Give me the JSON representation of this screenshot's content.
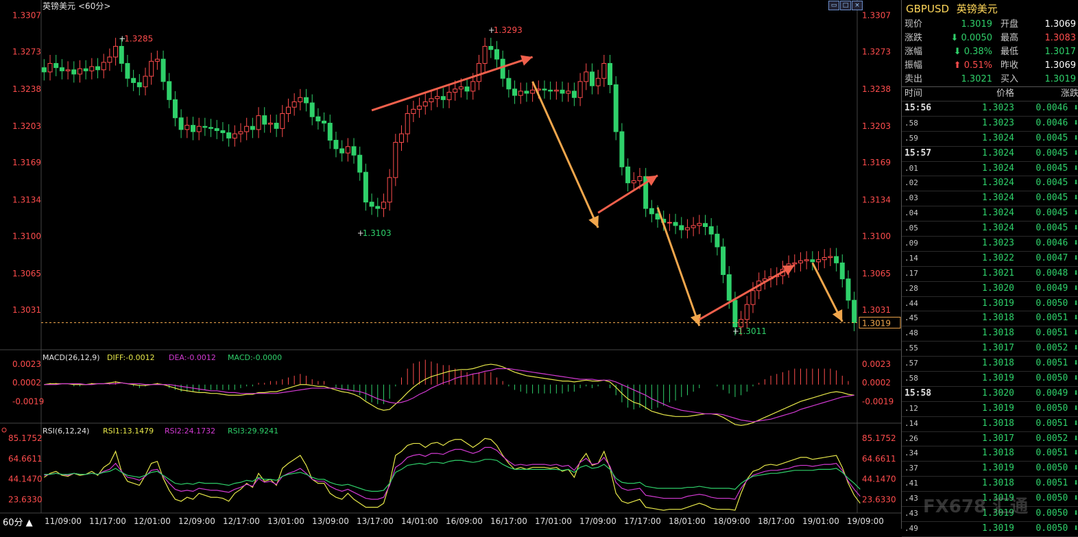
{
  "chart_title": "英镑美元",
  "chart_period_tag": "<60分>",
  "period_button": "60分 ▲",
  "window_icons": [
    "restore-icon",
    "maximize-icon",
    "close-icon"
  ],
  "watermark": "FX678 汇通",
  "colors": {
    "up": "#ff4d4d",
    "down": "#2fd06a",
    "bg": "#000000",
    "axis_price": "#ff4d4d",
    "arrow_red": "#f0604c",
    "arrow_orange": "#f0a64c",
    "macd_dif": "#e8e84a",
    "macd_dea": "#d23ad2",
    "rsi1": "#e8e84a",
    "rsi2": "#d23ad2",
    "rsi3": "#2fd06a"
  },
  "quote": {
    "code": "GBPUSD",
    "name": "英镑美元",
    "rows": [
      {
        "l1": "现价",
        "v1": "1.3019",
        "c1": "down",
        "l2": "开盘",
        "v2": "1.3069",
        "c2": "white"
      },
      {
        "l1": "涨跌",
        "v1": "0.0050",
        "c1": "down",
        "a1": "down",
        "l2": "最高",
        "v2": "1.3083",
        "c2": "up"
      },
      {
        "l1": "涨幅",
        "v1": "0.38%",
        "c1": "down",
        "a1": "down",
        "l2": "最低",
        "v2": "1.3017",
        "c2": "down"
      },
      {
        "l1": "振幅",
        "v1": "0.51%",
        "c1": "up",
        "a1": "up",
        "l2": "昨收",
        "v2": "1.3069",
        "c2": "white"
      },
      {
        "l1": "卖出",
        "v1": "1.3021",
        "c1": "down",
        "l2": "买入",
        "v2": "1.3019",
        "c2": "down"
      }
    ]
  },
  "ticks": {
    "headers": [
      "时间",
      "价格",
      "涨跌"
    ],
    "rows": [
      {
        "t": "15:56",
        "major": true,
        "p": "1.3023",
        "c": "0.0046"
      },
      {
        "t": ".58",
        "p": "1.3023",
        "c": "0.0046"
      },
      {
        "t": ".59",
        "p": "1.3024",
        "c": "0.0045"
      },
      {
        "t": "15:57",
        "major": true,
        "p": "1.3024",
        "c": "0.0045"
      },
      {
        "t": ".01",
        "p": "1.3024",
        "c": "0.0045"
      },
      {
        "t": ".02",
        "p": "1.3024",
        "c": "0.0045"
      },
      {
        "t": ".03",
        "p": "1.3024",
        "c": "0.0045"
      },
      {
        "t": ".04",
        "p": "1.3024",
        "c": "0.0045"
      },
      {
        "t": ".05",
        "p": "1.3024",
        "c": "0.0045"
      },
      {
        "t": ".09",
        "p": "1.3023",
        "c": "0.0046"
      },
      {
        "t": ".14",
        "p": "1.3022",
        "c": "0.0047"
      },
      {
        "t": ".17",
        "p": "1.3021",
        "c": "0.0048"
      },
      {
        "t": ".28",
        "p": "1.3020",
        "c": "0.0049"
      },
      {
        "t": ".44",
        "p": "1.3019",
        "c": "0.0050"
      },
      {
        "t": ".45",
        "p": "1.3018",
        "c": "0.0051"
      },
      {
        "t": ".48",
        "p": "1.3018",
        "c": "0.0051"
      },
      {
        "t": ".55",
        "p": "1.3017",
        "c": "0.0052"
      },
      {
        "t": ".57",
        "p": "1.3018",
        "c": "0.0051"
      },
      {
        "t": ".58",
        "p": "1.3019",
        "c": "0.0050"
      },
      {
        "t": "15:58",
        "major": true,
        "p": "1.3020",
        "c": "0.0049"
      },
      {
        "t": ".12",
        "p": "1.3019",
        "c": "0.0050"
      },
      {
        "t": ".14",
        "p": "1.3018",
        "c": "0.0051"
      },
      {
        "t": ".26",
        "p": "1.3017",
        "c": "0.0052"
      },
      {
        "t": ".34",
        "p": "1.3018",
        "c": "0.0051"
      },
      {
        "t": ".37",
        "p": "1.3019",
        "c": "0.0050"
      },
      {
        "t": ".41",
        "p": "1.3018",
        "c": "0.0051"
      },
      {
        "t": ".43",
        "p": "1.3019",
        "c": "0.0050"
      },
      {
        "t": ".43",
        "p": "1.3019",
        "c": "0.0050"
      },
      {
        "t": ".49",
        "p": "1.3019",
        "c": "0.0050"
      }
    ]
  },
  "chart_data": {
    "type": "candlestick",
    "price_ticks": [
      "1.3307",
      "1.3273",
      "1.3238",
      "1.3203",
      "1.3169",
      "1.3134",
      "1.3100",
      "1.3065",
      "1.3031"
    ],
    "price_range": [
      1.3,
      1.3315
    ],
    "current_price": "1.3019",
    "x_labels": [
      "11/09:00",
      "11/17:00",
      "12/01:00",
      "12/09:00",
      "12/17:00",
      "13/01:00",
      "13/09:00",
      "13/17:00",
      "14/01:00",
      "16/09:00",
      "16/17:00",
      "17/01:00",
      "17/09:00",
      "17/17:00",
      "18/01:00",
      "18/09:00",
      "18/17:00",
      "19/01:00",
      "19/09:00"
    ],
    "annotations": [
      {
        "label": "1.3285",
        "index": 13,
        "price": 1.3285
      },
      {
        "label": "1.3293",
        "index": 75,
        "price": 1.3293
      },
      {
        "label": "1.3103",
        "index": 53,
        "price": 1.3103
      },
      {
        "label": "1.3011",
        "index": 116,
        "price": 1.3011
      }
    ],
    "closes": [
      1.3254,
      1.3262,
      1.3258,
      1.3255,
      1.3256,
      1.3252,
      1.3257,
      1.3255,
      1.3259,
      1.3256,
      1.3263,
      1.3268,
      1.3278,
      1.3262,
      1.3248,
      1.3244,
      1.324,
      1.325,
      1.3264,
      1.3266,
      1.3245,
      1.3228,
      1.3211,
      1.32,
      1.3204,
      1.3198,
      1.3203,
      1.3202,
      1.3201,
      1.3199,
      1.3197,
      1.3192,
      1.3196,
      1.3198,
      1.3203,
      1.32,
      1.3213,
      1.3205,
      1.3206,
      1.3201,
      1.3215,
      1.3221,
      1.3226,
      1.323,
      1.3225,
      1.3212,
      1.3208,
      1.3206,
      1.319,
      1.3182,
      1.3178,
      1.3184,
      1.3176,
      1.316,
      1.3132,
      1.3128,
      1.3126,
      1.3132,
      1.3155,
      1.3188,
      1.3196,
      1.3215,
      1.3219,
      1.3222,
      1.3226,
      1.3229,
      1.3231,
      1.3228,
      1.3235,
      1.3238,
      1.324,
      1.3236,
      1.3245,
      1.3262,
      1.3278,
      1.3275,
      1.3266,
      1.3248,
      1.3238,
      1.3232,
      1.3236,
      1.3234,
      1.3237,
      1.3238,
      1.3237,
      1.3236,
      1.3237,
      1.3234,
      1.3236,
      1.323,
      1.3245,
      1.3254,
      1.3241,
      1.3248,
      1.3262,
      1.3242,
      1.3198,
      1.3165,
      1.315,
      1.3152,
      1.3156,
      1.3126,
      1.3121,
      1.3116,
      1.3113,
      1.3113,
      1.311,
      1.3106,
      1.3108,
      1.311,
      1.3112,
      1.3109,
      1.3102,
      1.309,
      1.3064,
      1.304,
      1.3015,
      1.3022,
      1.3036,
      1.3049,
      1.3058,
      1.306,
      1.3062,
      1.3063,
      1.3069,
      1.3074,
      1.3075,
      1.3077,
      1.3078,
      1.3076,
      1.3078,
      1.308,
      1.3081,
      1.3075,
      1.306,
      1.304,
      1.3019
    ],
    "opens": [
      1.3258,
      1.3254,
      1.3262,
      1.3258,
      1.3255,
      1.3256,
      1.3252,
      1.3257,
      1.3255,
      1.3259,
      1.3256,
      1.3263,
      1.3268,
      1.3278,
      1.3262,
      1.3248,
      1.3244,
      1.324,
      1.325,
      1.3264,
      1.3266,
      1.3245,
      1.3228,
      1.3211,
      1.32,
      1.3204,
      1.3198,
      1.3203,
      1.3202,
      1.3201,
      1.3199,
      1.3197,
      1.3192,
      1.3196,
      1.3198,
      1.3203,
      1.32,
      1.3213,
      1.3205,
      1.3206,
      1.3201,
      1.3215,
      1.3221,
      1.3226,
      1.323,
      1.3225,
      1.3212,
      1.3208,
      1.3206,
      1.319,
      1.3182,
      1.3178,
      1.3184,
      1.3176,
      1.316,
      1.3132,
      1.3128,
      1.3126,
      1.3132,
      1.3155,
      1.3188,
      1.3196,
      1.3215,
      1.3219,
      1.3222,
      1.3226,
      1.3229,
      1.3231,
      1.3228,
      1.3235,
      1.3238,
      1.324,
      1.3236,
      1.3245,
      1.3262,
      1.3278,
      1.3275,
      1.3266,
      1.3248,
      1.3238,
      1.3232,
      1.3236,
      1.3234,
      1.3237,
      1.3238,
      1.3237,
      1.3236,
      1.3237,
      1.3234,
      1.3236,
      1.323,
      1.3245,
      1.3254,
      1.3241,
      1.3248,
      1.3262,
      1.3242,
      1.3198,
      1.3165,
      1.315,
      1.3152,
      1.3156,
      1.3126,
      1.3121,
      1.3116,
      1.3113,
      1.3113,
      1.311,
      1.3106,
      1.3108,
      1.311,
      1.3112,
      1.3109,
      1.3102,
      1.309,
      1.3064,
      1.304,
      1.3015,
      1.3022,
      1.3036,
      1.3049,
      1.3058,
      1.306,
      1.3062,
      1.3063,
      1.3069,
      1.3074,
      1.3075,
      1.3077,
      1.3078,
      1.3076,
      1.3078,
      1.308,
      1.3081,
      1.3075,
      1.306,
      1.304
    ],
    "macd": {
      "label": "MACD(26,12,9)",
      "dif_label": "DIFF:-0.0012",
      "dea_label": "DEA:-0.0012",
      "macd_label": "MACD:-0.0000",
      "ticks": [
        "0.0023",
        "0.0002",
        "-0.0019"
      ],
      "range": [
        -0.0035,
        0.003
      ],
      "dif": [
        0.0,
        0.0001,
        0.0001,
        0.0001,
        0.0001,
        0.0,
        0.0,
        0.0,
        0.0001,
        0.0001,
        0.0001,
        0.0002,
        0.0003,
        0.0002,
        0.0001,
        0.0,
        -0.0001,
        -0.0001,
        0.0,
        0.0001,
        0.0,
        -0.0002,
        -0.0004,
        -0.0006,
        -0.0007,
        -0.0008,
        -0.0009,
        -0.0009,
        -0.001,
        -0.001,
        -0.0011,
        -0.0012,
        -0.0012,
        -0.0012,
        -0.0011,
        -0.0011,
        -0.0009,
        -0.0009,
        -0.0008,
        -0.0008,
        -0.0006,
        -0.0004,
        -0.0002,
        0.0,
        0.0,
        -0.0001,
        -0.0002,
        -0.0002,
        -0.0004,
        -0.0006,
        -0.0008,
        -0.0009,
        -0.0011,
        -0.0014,
        -0.0019,
        -0.0023,
        -0.0027,
        -0.0029,
        -0.0028,
        -0.0022,
        -0.0016,
        -0.0009,
        -0.0003,
        0.0002,
        0.0006,
        0.0009,
        0.0011,
        0.0013,
        0.0015,
        0.0016,
        0.0017,
        0.0017,
        0.0018,
        0.002,
        0.0022,
        0.0023,
        0.0022,
        0.002,
        0.0017,
        0.0014,
        0.0012,
        0.001,
        0.0009,
        0.0008,
        0.0007,
        0.0006,
        0.0005,
        0.0004,
        0.0004,
        0.0003,
        0.0004,
        0.0005,
        0.0004,
        0.0004,
        0.0005,
        0.0003,
        -0.0003,
        -0.001,
        -0.0016,
        -0.002,
        -0.0022,
        -0.0026,
        -0.003,
        -0.0032,
        -0.0034,
        -0.0035,
        -0.0036,
        -0.0036,
        -0.0036,
        -0.0035,
        -0.0034,
        -0.0033,
        -0.0033,
        -0.0034,
        -0.0037,
        -0.0041,
        -0.0045,
        -0.0046,
        -0.0045,
        -0.0043,
        -0.004,
        -0.0037,
        -0.0034,
        -0.0031,
        -0.0028,
        -0.0025,
        -0.0022,
        -0.0019,
        -0.0017,
        -0.0015,
        -0.0013,
        -0.0011,
        -0.0009,
        -0.0008,
        -0.0009,
        -0.0011,
        -0.0012
      ],
      "dea": [
        0.0,
        0.0,
        0.0,
        0.0001,
        0.0001,
        0.0001,
        0.0001,
        0.0,
        0.0,
        0.0001,
        0.0001,
        0.0001,
        0.0001,
        0.0002,
        0.0001,
        0.0001,
        0.0001,
        0.0,
        0.0,
        0.0,
        0.0,
        0.0,
        -0.0001,
        -0.0002,
        -0.0003,
        -0.0004,
        -0.0005,
        -0.0006,
        -0.0007,
        -0.0007,
        -0.0008,
        -0.0009,
        -0.0009,
        -0.001,
        -0.001,
        -0.001,
        -0.001,
        -0.001,
        -0.001,
        -0.001,
        -0.0009,
        -0.0008,
        -0.0007,
        -0.0006,
        -0.0005,
        -0.0004,
        -0.0004,
        -0.0004,
        -0.0004,
        -0.0004,
        -0.0005,
        -0.0006,
        -0.0007,
        -0.0008,
        -0.001,
        -0.0013,
        -0.0016,
        -0.0018,
        -0.002,
        -0.0021,
        -0.002,
        -0.0018,
        -0.0015,
        -0.0011,
        -0.0008,
        -0.0004,
        -0.0001,
        0.0002,
        0.0004,
        0.0007,
        0.0009,
        0.001,
        0.0012,
        0.0013,
        0.0015,
        0.0016,
        0.0018,
        0.0018,
        0.0018,
        0.0017,
        0.0016,
        0.0015,
        0.0014,
        0.0013,
        0.0012,
        0.0011,
        0.001,
        0.0009,
        0.0008,
        0.0007,
        0.0006,
        0.0006,
        0.0006,
        0.0005,
        0.0005,
        0.0005,
        0.0003,
        0.0,
        -0.0003,
        -0.0006,
        -0.0009,
        -0.0012,
        -0.0016,
        -0.0019,
        -0.0022,
        -0.0025,
        -0.0027,
        -0.0029,
        -0.003,
        -0.0031,
        -0.0032,
        -0.0033,
        -0.0033,
        -0.0033,
        -0.0034,
        -0.0036,
        -0.0038,
        -0.004,
        -0.0041,
        -0.0042,
        -0.0041,
        -0.004,
        -0.0039,
        -0.0037,
        -0.0035,
        -0.0033,
        -0.0031,
        -0.0028,
        -0.0026,
        -0.0024,
        -0.0022,
        -0.002,
        -0.0018,
        -0.0016,
        -0.0014,
        -0.0013,
        -0.0012
      ]
    },
    "rsi": {
      "label": "RSI(6,12,24)",
      "rsi1_label": "RSI1:13.1479",
      "rsi2_label": "RSI2:24.1732",
      "rsi3_label": "RSI3:29.9241",
      "ticks": [
        "85.1752",
        "64.6611",
        "44.1470",
        "23.6330"
      ],
      "range": [
        13.0,
        90.0
      ],
      "rsi1": [
        46,
        50,
        52,
        48,
        47,
        50,
        48,
        49,
        52,
        48,
        56,
        60,
        72,
        52,
        42,
        40,
        38,
        48,
        60,
        62,
        45,
        33,
        24,
        22,
        26,
        24,
        30,
        28,
        26,
        26,
        25,
        22,
        30,
        34,
        40,
        36,
        50,
        42,
        44,
        38,
        55,
        60,
        64,
        68,
        58,
        44,
        40,
        40,
        30,
        26,
        24,
        30,
        24,
        20,
        16,
        16,
        16,
        20,
        40,
        68,
        72,
        78,
        80,
        80,
        76,
        80,
        81,
        78,
        82,
        84,
        84,
        80,
        76,
        80,
        85,
        84,
        78,
        68,
        60,
        54,
        56,
        54,
        56,
        56,
        56,
        55,
        56,
        52,
        54,
        46,
        62,
        70,
        58,
        60,
        72,
        55,
        30,
        22,
        20,
        22,
        24,
        16,
        15,
        14,
        13,
        14,
        14,
        14,
        16,
        18,
        20,
        18,
        15,
        14,
        14,
        14,
        13,
        30,
        44,
        52,
        54,
        58,
        59,
        58,
        60,
        62,
        64,
        66,
        66,
        64,
        65,
        66,
        67,
        68,
        56,
        40,
        28,
        20
      ],
      "rsi2": [
        48,
        49,
        50,
        49,
        48,
        50,
        49,
        49,
        50,
        49,
        52,
        54,
        60,
        52,
        46,
        45,
        43,
        47,
        53,
        54,
        47,
        40,
        34,
        32,
        33,
        32,
        35,
        34,
        33,
        33,
        32,
        31,
        34,
        36,
        39,
        37,
        45,
        41,
        42,
        39,
        47,
        50,
        52,
        55,
        50,
        44,
        42,
        42,
        37,
        34,
        32,
        34,
        31,
        28,
        25,
        24,
        24,
        26,
        38,
        56,
        60,
        66,
        68,
        69,
        67,
        70,
        70,
        69,
        72,
        74,
        74,
        72,
        70,
        72,
        76,
        76,
        73,
        67,
        62,
        58,
        59,
        58,
        59,
        59,
        59,
        58,
        59,
        57,
        58,
        53,
        61,
        65,
        59,
        60,
        66,
        57,
        41,
        35,
        33,
        34,
        35,
        28,
        27,
        26,
        25,
        25,
        25,
        25,
        27,
        28,
        29,
        28,
        26,
        25,
        25,
        25,
        24,
        35,
        43,
        48,
        50,
        52,
        53,
        53,
        54,
        55,
        57,
        58,
        58,
        57,
        58,
        59,
        59,
        60,
        53,
        42,
        34,
        27
      ],
      "rsi3": [
        49,
        49,
        50,
        49,
        49,
        50,
        49,
        49,
        50,
        49,
        51,
        52,
        55,
        51,
        48,
        47,
        46,
        48,
        51,
        52,
        48,
        44,
        40,
        39,
        40,
        39,
        41,
        40,
        40,
        40,
        39,
        38,
        40,
        41,
        43,
        42,
        46,
        44,
        44,
        43,
        47,
        49,
        50,
        51,
        49,
        46,
        44,
        44,
        41,
        39,
        38,
        39,
        37,
        35,
        33,
        32,
        32,
        33,
        40,
        51,
        54,
        58,
        59,
        60,
        59,
        61,
        61,
        60,
        62,
        63,
        63,
        62,
        61,
        62,
        64,
        64,
        63,
        59,
        56,
        54,
        54,
        54,
        54,
        54,
        54,
        54,
        54,
        53,
        54,
        51,
        56,
        58,
        55,
        56,
        59,
        54,
        45,
        41,
        40,
        40,
        41,
        37,
        36,
        35,
        35,
        35,
        35,
        35,
        36,
        36,
        37,
        36,
        35,
        35,
        35,
        35,
        34,
        40,
        44,
        47,
        48,
        49,
        50,
        50,
        51,
        52,
        53,
        53,
        53,
        53,
        54,
        54,
        54,
        55,
        51,
        45,
        40,
        34
      ]
    }
  }
}
